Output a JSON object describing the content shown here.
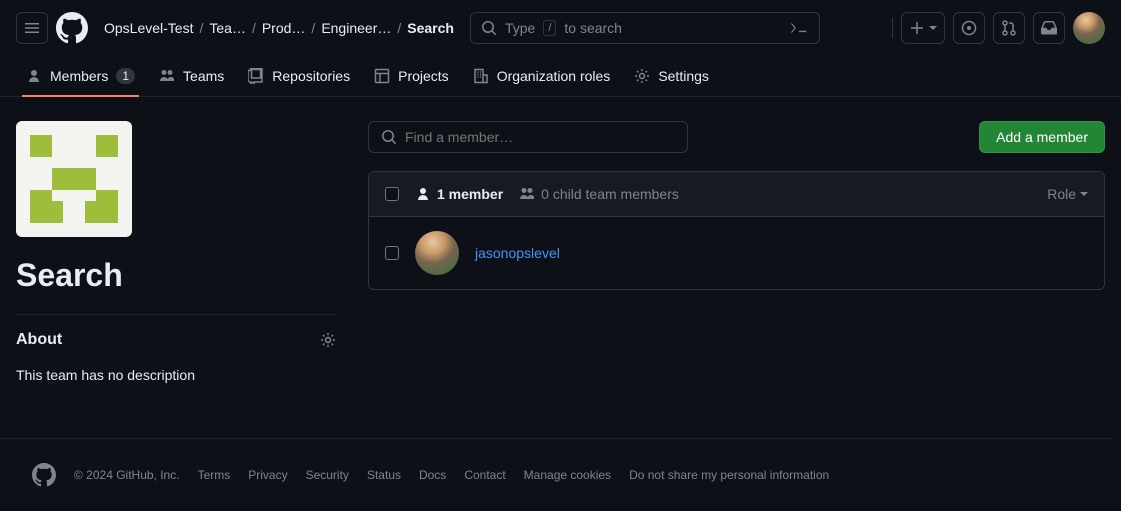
{
  "header": {
    "breadcrumb": [
      {
        "label": "OpsLevel-Test"
      },
      {
        "label": "Tea…"
      },
      {
        "label": "Prod…"
      },
      {
        "label": "Engineer…"
      },
      {
        "label": "Search",
        "current": true
      }
    ],
    "search_prefix": "Type",
    "search_kbd": "/",
    "search_suffix": "to search"
  },
  "subnav": {
    "items": [
      {
        "label": "Members",
        "badge": "1",
        "icon": "person",
        "active": true
      },
      {
        "label": "Teams",
        "icon": "people"
      },
      {
        "label": "Repositories",
        "icon": "repo"
      },
      {
        "label": "Projects",
        "icon": "project"
      },
      {
        "label": "Organization roles",
        "icon": "org"
      },
      {
        "label": "Settings",
        "icon": "gear"
      }
    ]
  },
  "sidebar": {
    "team_name": "Search",
    "about_heading": "About",
    "about_description": "This team has no description"
  },
  "content": {
    "find_placeholder": "Find a member…",
    "add_button": "Add a member",
    "table_header": {
      "member_count": "1 member",
      "child_count": "0 child team members",
      "role_label": "Role"
    },
    "members": [
      {
        "username": "jasonopslevel"
      }
    ]
  },
  "footer": {
    "copyright": "© 2024 GitHub, Inc.",
    "links": [
      "Terms",
      "Privacy",
      "Security",
      "Status",
      "Docs",
      "Contact",
      "Manage cookies",
      "Do not share my personal information"
    ]
  }
}
